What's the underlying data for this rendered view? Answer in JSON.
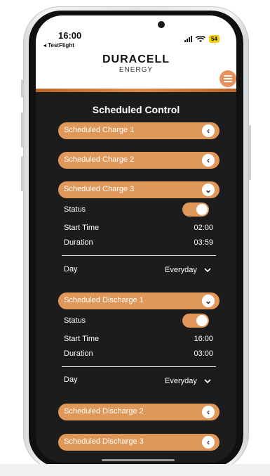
{
  "status_bar": {
    "time": "16:00",
    "back_app": "◂ TestFlight",
    "battery": "54"
  },
  "header": {
    "brand_name": "DURACELL",
    "brand_sub": "ENERGY",
    "menu_icon": "hamburger-icon"
  },
  "page": {
    "title": "Scheduled Control"
  },
  "sections": {
    "charge1": {
      "label": "Scheduled Charge 1",
      "icon": "chevron-left-icon"
    },
    "charge2": {
      "label": "Scheduled Charge 2",
      "icon": "chevron-left-icon"
    },
    "charge3": {
      "label": "Scheduled Charge 3",
      "icon": "chevron-down-icon",
      "status_label": "Status",
      "status_on": true,
      "start_label": "Start Time",
      "start_value": "02:00",
      "duration_label": "Duration",
      "duration_value": "03:59",
      "day_label": "Day",
      "day_value": "Everyday"
    },
    "discharge1": {
      "label": "Scheduled Discharge 1",
      "icon": "chevron-down-icon",
      "status_label": "Status",
      "status_on": true,
      "start_label": "Start Time",
      "start_value": "16:00",
      "duration_label": "Duration",
      "duration_value": "03:00",
      "day_label": "Day",
      "day_value": "Everyday"
    },
    "discharge2": {
      "label": "Scheduled Discharge 2",
      "icon": "chevron-left-icon"
    },
    "discharge3": {
      "label": "Scheduled Discharge 3",
      "icon": "chevron-left-icon"
    }
  },
  "colors": {
    "accent": "#e0975a",
    "background": "#1c1c1c",
    "text": "#ffffff"
  }
}
